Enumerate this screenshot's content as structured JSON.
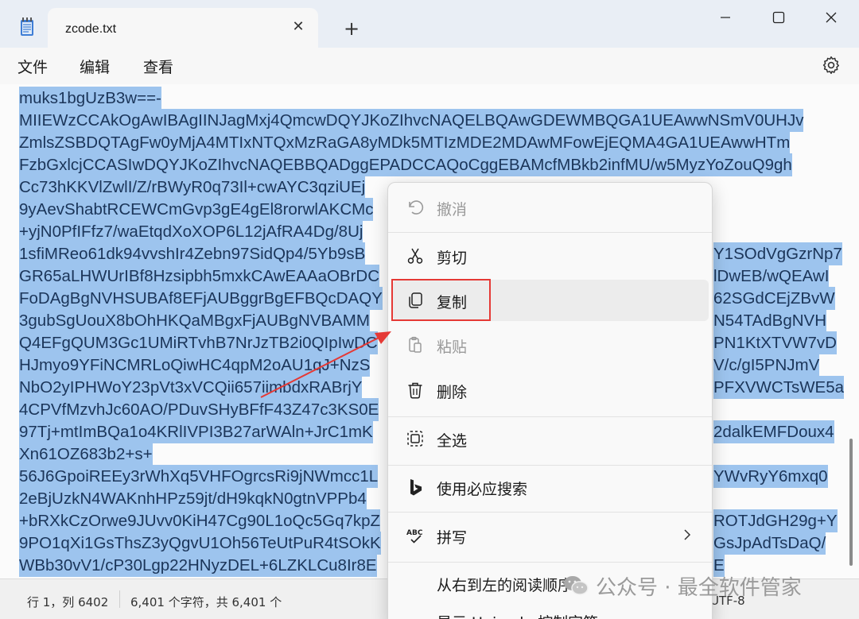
{
  "window": {
    "tab_title": "zcode.txt",
    "tab_close_icon": "close-icon",
    "new_tab_icon": "plus-icon",
    "controls": [
      "minimize-icon",
      "maximize-icon",
      "close-icon"
    ]
  },
  "menubar": {
    "items": [
      "文件",
      "编辑",
      "查看"
    ],
    "settings_icon": "gear-icon"
  },
  "editor": {
    "lines": [
      "muks1bgUzB3w==-",
      "MIIEWzCCAkOgAwIBAgIINJagMxj4QmcwDQYJKoZIhvcNAQELBQAwGDEWMBQGA1UEAwwNSmV0UHJv",
      "ZmlsZSBDQTAgFw0yMjA4MTIxNTQxMzRaGA8yMDk5MTIzMDE2MDAwMFowEjEQMA4GA1UEAwwHTm",
      "FzbGxlcjCCASIwDQYJKoZIhvcNAQEBBQADggEPADCCAQoCggEBAMcfMBkb2infMU/w5MyzYoZouQ9gh",
      "Cc73hKKVlZwlI/Z/rBWyR0q73Il+cwAYC3qziUEj",
      "9yAevShabtRCEWCmGvp3gE4gEl8rorwlAKCMc",
      "+yjN0PfIFfz7/waEtqdXoXOP6L12jAfRA4Dg/8Uj",
      "1sfiMReo61dk94vvshIr4Zebn97SidQp4/5Yb9sB",
      "GR65aLHWUrIBf8Hzsipbh5mxkCAwEAAaOBrDC",
      "FoDAgBgNVHSUBAf8EFjAUBggrBgEFBQcDAQY",
      "3gubSgUouX8bOhHKQaMBgxFjAUBgNVBAMM",
      "Q4EFgQUM3Gc1UMiRTvhB7NrJzTB2i0QIpIwDC",
      "HJmyo9YFiNCMRLoQiwHC4qpM2oAU1qJ+NzS",
      "NbO2yIPHWoY23pVt3xVCQii657iimbdxRABrjY",
      "4CPVfMzvhJc60AO/PDuvSHyBFfF43Z47c3KS0E",
      "97Tj+mtImBQa1o4KRlIVPI3B27arWAln+JrC1mK",
      "Xn61OZ683b2+s+",
      "56J6GpoiREEy3rWhXq5VHFOgrcsRi9jNWmcc1L",
      "2eBjUzkN4WAKnhHPz59jt/dH9kqkN0gtnVPPb4",
      "+bRXkCzOrwe9JUvv0KiH47Cg90L1oQc5Gq7kpZ",
      "9PO1qXi1GsThsZ3yQgvU1Oh56TeUtPuR4tSOkK",
      "WBb30vV1/cP30Lgp22HNyzDEL+6LZKLCu8Ir8E"
    ],
    "right_fragments": [
      "Y1SOdVgGzrNp7",
      "lDwEB/wQEAwI",
      "62SGdCEjZBvW",
      "N54TAdBgNVH",
      "PN1KtXTVW7vD",
      "V/c/gI5PNJmV",
      "PFXVWCTsWE5a",
      "2dalkEMFDoux4",
      "YWvRyY6mxq0",
      "ROTJdGH29g+Y",
      "GsJpAdTsDaQ/",
      "E"
    ]
  },
  "context_menu": {
    "items": [
      {
        "label": "撤消",
        "icon": "undo-icon",
        "disabled": true
      },
      {
        "label": "剪切",
        "icon": "scissors-icon",
        "disabled": false
      },
      {
        "label": "复制",
        "icon": "copy-icon",
        "disabled": false
      },
      {
        "label": "粘贴",
        "icon": "clipboard-icon",
        "disabled": true
      },
      {
        "label": "删除",
        "icon": "trash-icon",
        "disabled": false
      },
      {
        "label": "全选",
        "icon": "select-all-icon",
        "disabled": false
      },
      {
        "label": "使用必应搜索",
        "icon": "bing-icon",
        "disabled": false
      },
      {
        "label": "拼写",
        "icon": "spellcheck-icon",
        "disabled": false
      },
      {
        "label": "从右到左的阅读顺序",
        "icon": "",
        "disabled": false
      },
      {
        "label": "显示 Unicode 控制字符",
        "icon": "",
        "disabled": false
      }
    ]
  },
  "statusbar": {
    "position": "行 1，列 6402",
    "char_count": "6,401 个字符，共 6,401 个",
    "encoding": "UTF-8"
  },
  "watermark": {
    "icon": "wechat-icon",
    "text": "公众号 · 最全软件管家"
  },
  "colors": {
    "selection": "#9dc4ee",
    "highlight_box": "#e53935",
    "annotation_arrow": "#e53935"
  }
}
